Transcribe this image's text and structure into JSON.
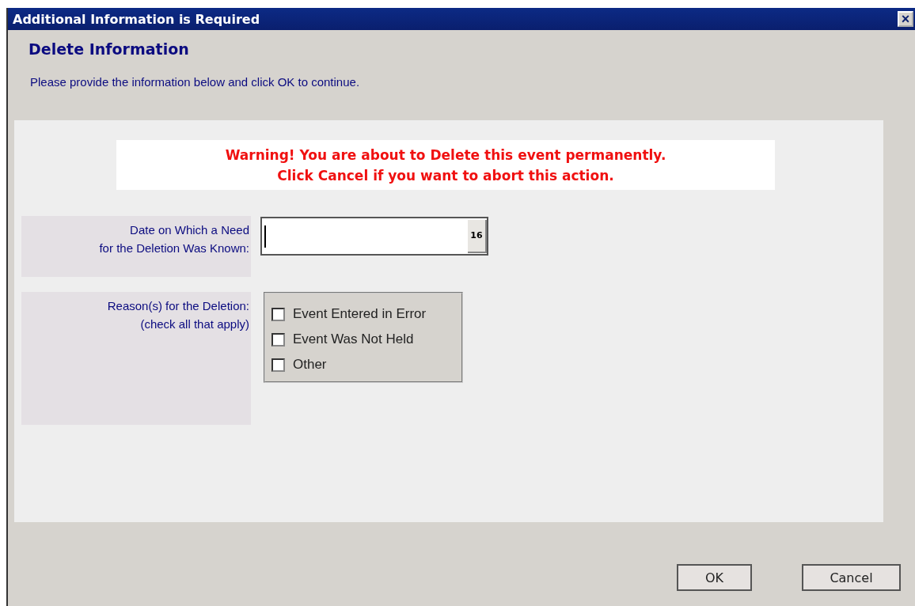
{
  "window": {
    "title": "Additional Information is Required",
    "close": "×"
  },
  "heading": "Delete Information",
  "instructions": "Please provide the information below and click OK to continue.",
  "warning": [
    "Warning! You are about to Delete this event permanently.",
    "Click Cancel if you want to abort this action."
  ],
  "date_field": {
    "label": [
      "Date on Which a Need",
      "for the Deletion Was Known:"
    ],
    "calendar_button": "16"
  },
  "reasons": {
    "label": "Reason(s) for the Deletion:",
    "hint": "(check all that apply)",
    "options": [
      {
        "label": "Event Entered in Error",
        "checked": false
      },
      {
        "label": "Event Was Not Held",
        "checked": false
      },
      {
        "label": "Other",
        "checked": false
      }
    ]
  },
  "buttons": [
    "OK",
    "Cancel"
  ]
}
